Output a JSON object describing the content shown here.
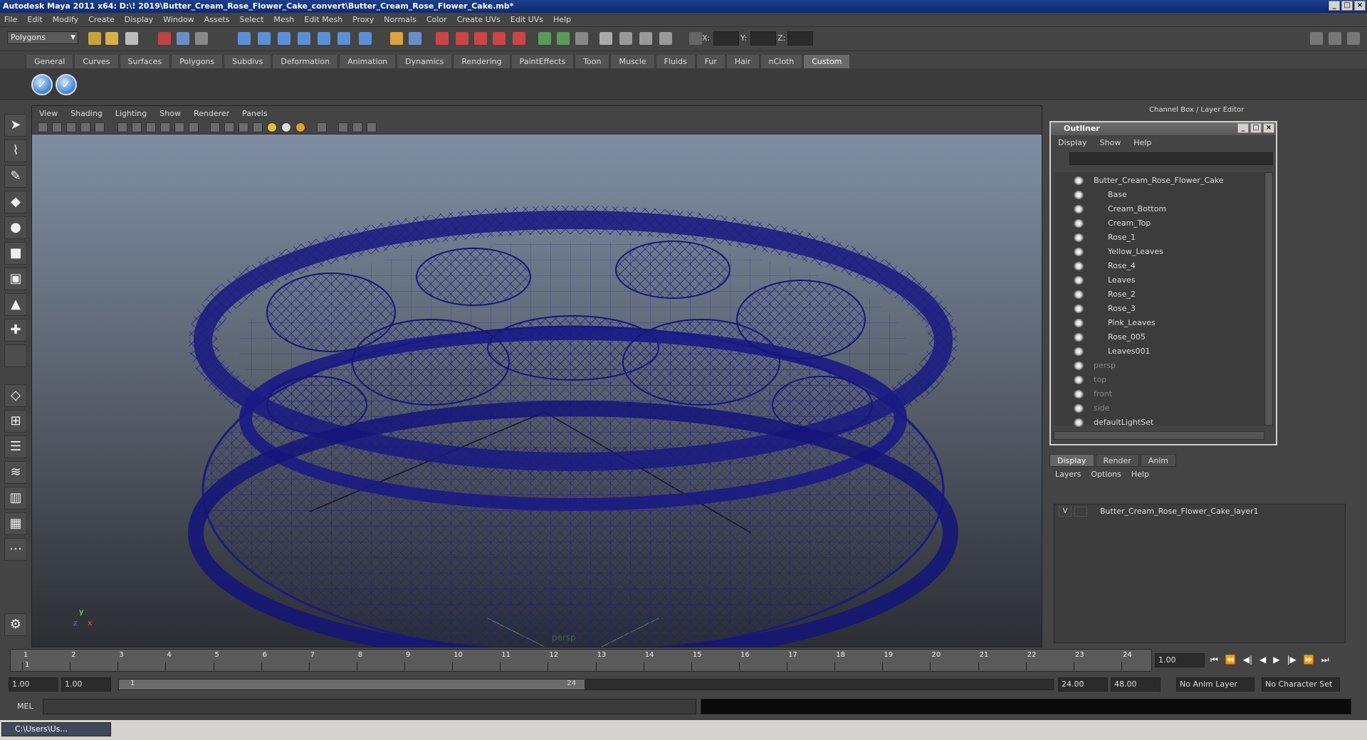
{
  "window": {
    "title": "Autodesk Maya 2011 x64: D:\\! 2019\\Butter_Cream_Rose_Flower_Cake_convert\\Butter_Cream_Rose_Flower_Cake.mb*"
  },
  "menubar": [
    "File",
    "Edit",
    "Modify",
    "Create",
    "Display",
    "Window",
    "Assets",
    "Select",
    "Mesh",
    "Edit Mesh",
    "Proxy",
    "Normals",
    "Color",
    "Create UVs",
    "Edit UVs",
    "Help"
  ],
  "statusline": {
    "mode": "Polygons",
    "x_label": "X:",
    "y_label": "Y:",
    "z_label": "Z:"
  },
  "shelf_tabs": [
    "General",
    "Curves",
    "Surfaces",
    "Polygons",
    "Subdivs",
    "Deformation",
    "Animation",
    "Dynamics",
    "Rendering",
    "PaintEffects",
    "Toon",
    "Muscle",
    "Fluids",
    "Fur",
    "Hair",
    "nCloth",
    "Custom"
  ],
  "active_shelf": "Custom",
  "viewport": {
    "menu": [
      "View",
      "Shading",
      "Lighting",
      "Show",
      "Renderer",
      "Panels"
    ],
    "camera": "persp",
    "axis": {
      "x": "x",
      "y": "y",
      "z": "z"
    }
  },
  "right_panel": {
    "header": "Channel Box / Layer Editor"
  },
  "outliner": {
    "title": "Outliner",
    "menu": [
      "Display",
      "Show",
      "Help"
    ],
    "items": [
      {
        "label": "Butter_Cream_Rose_Flower_Cake",
        "level": 0,
        "dim": false
      },
      {
        "label": "Base",
        "level": 1,
        "dim": false
      },
      {
        "label": "Cream_Bottom",
        "level": 1,
        "dim": false
      },
      {
        "label": "Cream_Top",
        "level": 1,
        "dim": false
      },
      {
        "label": "Rose_1",
        "level": 1,
        "dim": false
      },
      {
        "label": "Yellow_Leaves",
        "level": 1,
        "dim": false
      },
      {
        "label": "Rose_4",
        "level": 1,
        "dim": false
      },
      {
        "label": "Leaves",
        "level": 1,
        "dim": false
      },
      {
        "label": "Rose_2",
        "level": 1,
        "dim": false
      },
      {
        "label": "Rose_3",
        "level": 1,
        "dim": false
      },
      {
        "label": "Pink_Leaves",
        "level": 1,
        "dim": false
      },
      {
        "label": "Rose_005",
        "level": 1,
        "dim": false
      },
      {
        "label": "Leaves001",
        "level": 1,
        "dim": false
      },
      {
        "label": "persp",
        "level": 0,
        "dim": true
      },
      {
        "label": "top",
        "level": 0,
        "dim": true
      },
      {
        "label": "front",
        "level": 0,
        "dim": true
      },
      {
        "label": "side",
        "level": 0,
        "dim": true
      },
      {
        "label": "defaultLightSet",
        "level": 0,
        "dim": false
      }
    ]
  },
  "layer_editor": {
    "tabs": [
      "Display",
      "Render",
      "Anim"
    ],
    "active_tab": "Display",
    "menu": [
      "Layers",
      "Options",
      "Help"
    ],
    "layers": [
      {
        "visible": "V",
        "name": "Butter_Cream_Rose_Flower_Cake_layer1"
      }
    ]
  },
  "timeline": {
    "frames": [
      "1",
      "2",
      "3",
      "4",
      "5",
      "6",
      "7",
      "8",
      "9",
      "10",
      "11",
      "12",
      "13",
      "14",
      "15",
      "16",
      "17",
      "18",
      "19",
      "20",
      "21",
      "22",
      "23",
      "24"
    ],
    "current_frame_marker": "1",
    "current_time": "1.00"
  },
  "range": {
    "start": "1.00",
    "anim_start": "1.00",
    "slider_start": "1",
    "slider_end": "24",
    "anim_end": "24.00",
    "end": "48.00",
    "anim_layer": "No Anim Layer",
    "character_set": "No Character Set"
  },
  "cmdline": {
    "label": "MEL"
  },
  "taskbar": {
    "item": "C:\\Users\\Us..."
  }
}
